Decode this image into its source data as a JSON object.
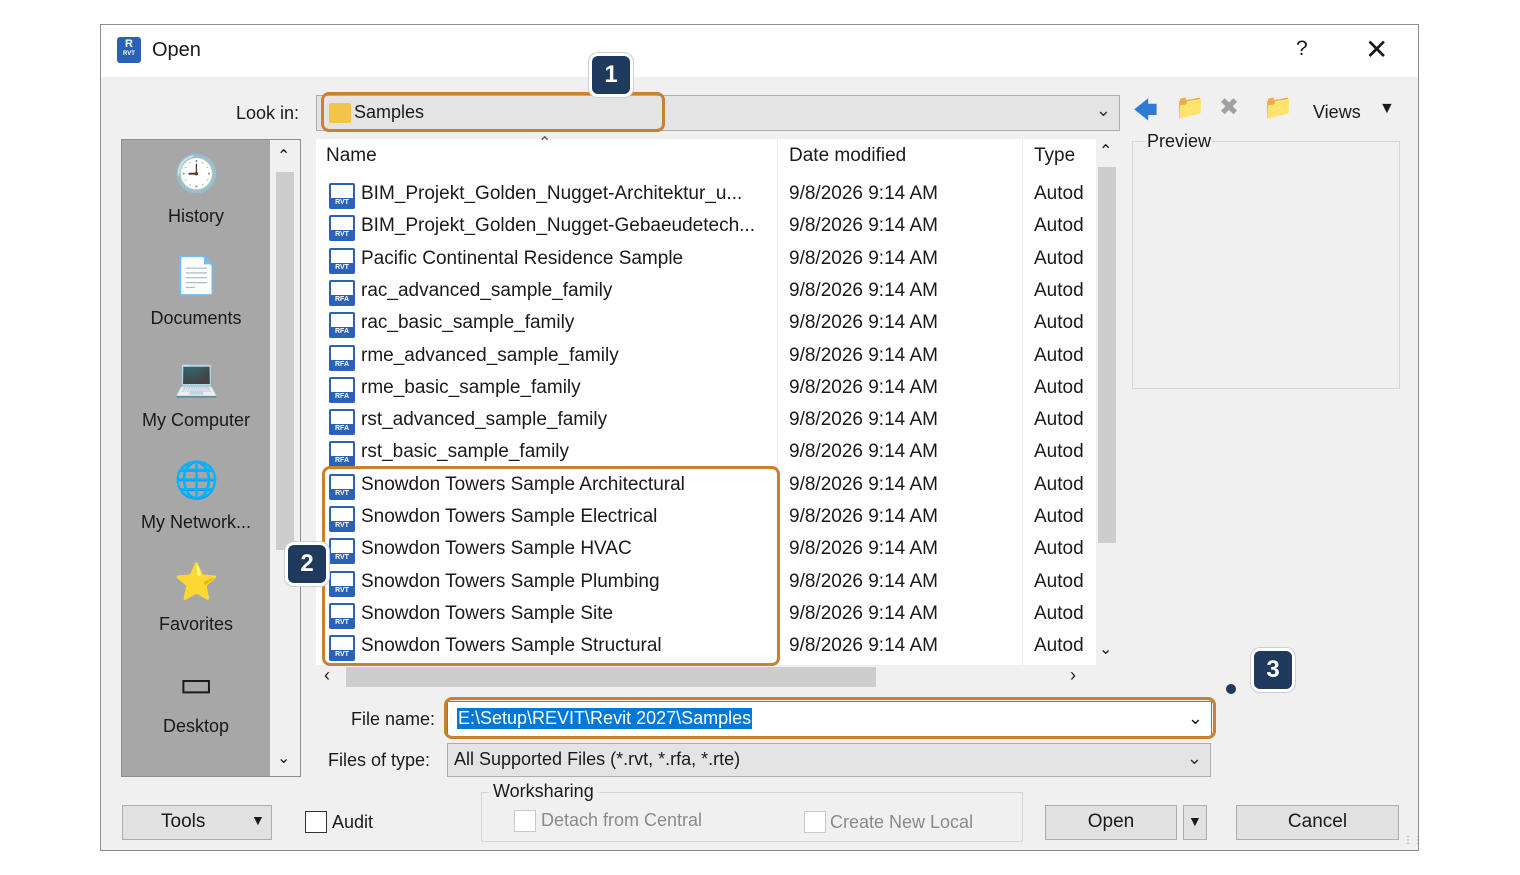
{
  "window": {
    "title": "Open",
    "help_label": "?",
    "close_label": "✕",
    "app_icon_letter": "R",
    "app_icon_sub": "RVT"
  },
  "look_in": {
    "label": "Look in:",
    "value": "Samples"
  },
  "toolbar": {
    "views_label": "Views"
  },
  "places": [
    {
      "label": "History",
      "icon": "history-icon"
    },
    {
      "label": "Documents",
      "icon": "documents-icon"
    },
    {
      "label": "My Computer",
      "icon": "computer-icon"
    },
    {
      "label": "My Network...",
      "icon": "network-icon"
    },
    {
      "label": "Favorites",
      "icon": "favorites-icon"
    },
    {
      "label": "Desktop",
      "icon": "desktop-icon"
    }
  ],
  "file_list": {
    "columns": [
      "Name",
      "Date modified",
      "Type"
    ],
    "rows": [
      {
        "name": "BIM_Projekt_Golden_Nugget-Architektur_u...",
        "date": "9/8/2026 9:14 AM",
        "type": "Autod",
        "ext": "RVT"
      },
      {
        "name": "BIM_Projekt_Golden_Nugget-Gebaeudetech...",
        "date": "9/8/2026 9:14 AM",
        "type": "Autod",
        "ext": "RVT"
      },
      {
        "name": "Pacific Continental Residence Sample",
        "date": "9/8/2026 9:14 AM",
        "type": "Autod",
        "ext": "RVT"
      },
      {
        "name": "rac_advanced_sample_family",
        "date": "9/8/2026 9:14 AM",
        "type": "Autod",
        "ext": "RFA"
      },
      {
        "name": "rac_basic_sample_family",
        "date": "9/8/2026 9:14 AM",
        "type": "Autod",
        "ext": "RFA"
      },
      {
        "name": "rme_advanced_sample_family",
        "date": "9/8/2026 9:14 AM",
        "type": "Autod",
        "ext": "RFA"
      },
      {
        "name": "rme_basic_sample_family",
        "date": "9/8/2026 9:14 AM",
        "type": "Autod",
        "ext": "RFA"
      },
      {
        "name": "rst_advanced_sample_family",
        "date": "9/8/2026 9:14 AM",
        "type": "Autod",
        "ext": "RFA"
      },
      {
        "name": "rst_basic_sample_family",
        "date": "9/8/2026 9:14 AM",
        "type": "Autod",
        "ext": "RFA"
      },
      {
        "name": "Snowdon Towers Sample Architectural",
        "date": "9/8/2026 9:14 AM",
        "type": "Autod",
        "ext": "RVT"
      },
      {
        "name": "Snowdon Towers Sample Electrical",
        "date": "9/8/2026 9:14 AM",
        "type": "Autod",
        "ext": "RVT"
      },
      {
        "name": "Snowdon Towers Sample HVAC",
        "date": "9/8/2026 9:14 AM",
        "type": "Autod",
        "ext": "RVT"
      },
      {
        "name": "Snowdon Towers Sample Plumbing",
        "date": "9/8/2026 9:14 AM",
        "type": "Autod",
        "ext": "RVT"
      },
      {
        "name": "Snowdon Towers Sample Site",
        "date": "9/8/2026 9:14 AM",
        "type": "Autod",
        "ext": "RVT"
      },
      {
        "name": "Snowdon Towers Sample Structural",
        "date": "9/8/2026 9:14 AM",
        "type": "Autod",
        "ext": "RVT"
      }
    ]
  },
  "preview": {
    "label": "Preview"
  },
  "file_name": {
    "label": "File name:",
    "value": "E:\\Setup\\REVIT\\Revit 2027\\Samples"
  },
  "files_of_type": {
    "label": "Files of type:",
    "value": "All Supported Files (*.rvt, *.rfa, *.rte)"
  },
  "worksharing": {
    "label": "Worksharing",
    "detach_label": "Detach from Central",
    "create_local_label": "Create New Local"
  },
  "buttons": {
    "tools": "Tools",
    "audit": "Audit",
    "open": "Open",
    "cancel": "Cancel"
  },
  "callouts": [
    "1",
    "2",
    "3"
  ],
  "colors": {
    "highlight": "#c8812f",
    "callout": "#1f3a5c",
    "accent": "#2a62b8",
    "selection": "#0078d7"
  }
}
